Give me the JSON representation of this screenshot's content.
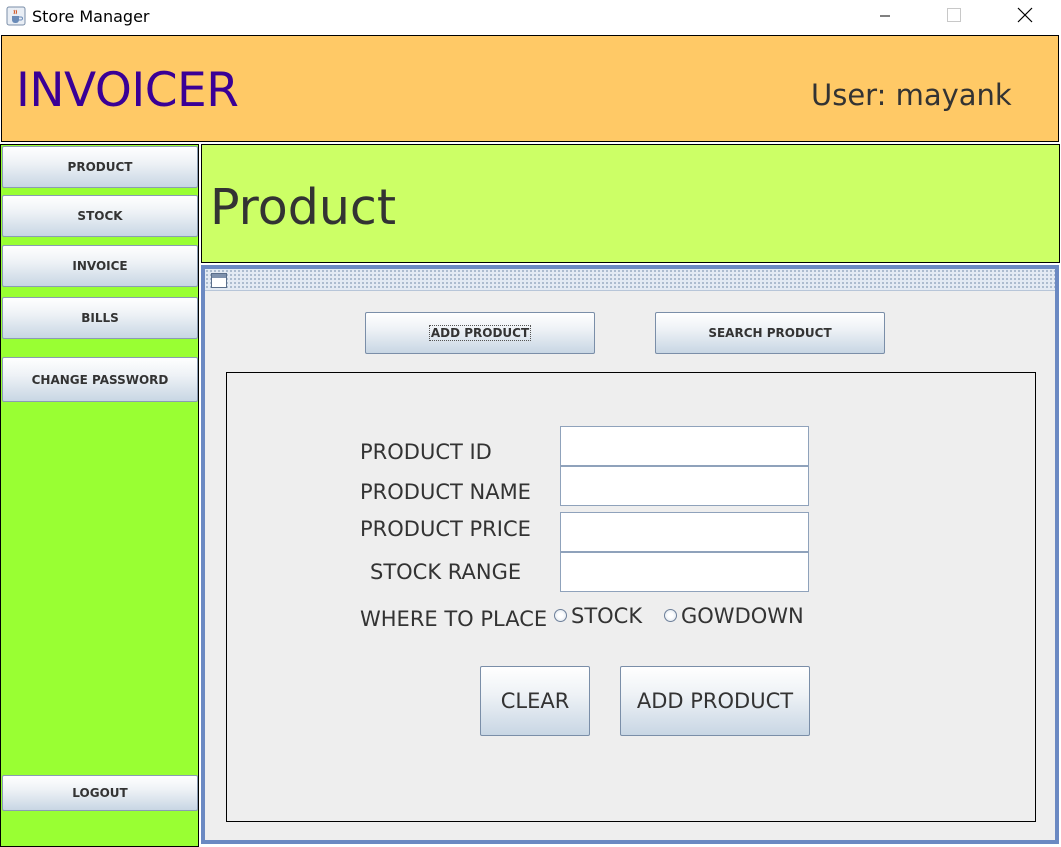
{
  "window": {
    "title": "Store Manager",
    "app_icon": "java-cup-icon",
    "controls": {
      "minimize": "minimize-icon",
      "maximize": "maximize-icon",
      "close": "close-icon"
    }
  },
  "header": {
    "brand": "INVOICER",
    "user_label": "User: mayank",
    "background": "#ffc966",
    "brand_color": "#3a0096"
  },
  "sidebar": {
    "background": "#99ff33",
    "items": [
      {
        "label": "PRODUCT"
      },
      {
        "label": "STOCK"
      },
      {
        "label": "INVOICE"
      },
      {
        "label": "BILLS"
      },
      {
        "label": "CHANGE PASSWORD"
      }
    ],
    "logout_label": "LOGOUT"
  },
  "page": {
    "title": "Product",
    "background": "#ccff66"
  },
  "product_frame": {
    "frame_icon": "internal-frame-icon",
    "add_product_tab": "ADD PRODUCT",
    "search_product_tab": "SEARCH PRODUCT",
    "form": {
      "product_id_label": "PRODUCT ID",
      "product_id_value": "",
      "product_name_label": "PRODUCT NAME",
      "product_name_value": "",
      "product_price_label": "PRODUCT PRICE",
      "product_price_value": "",
      "stock_range_label": "STOCK RANGE",
      "stock_range_value": "",
      "where_to_place_label": "WHERE TO PLACE",
      "place_options": [
        "STOCK",
        "GOWDOWN"
      ],
      "place_selected": null,
      "clear_label": "CLEAR",
      "submit_label": "ADD PRODUCT"
    }
  }
}
